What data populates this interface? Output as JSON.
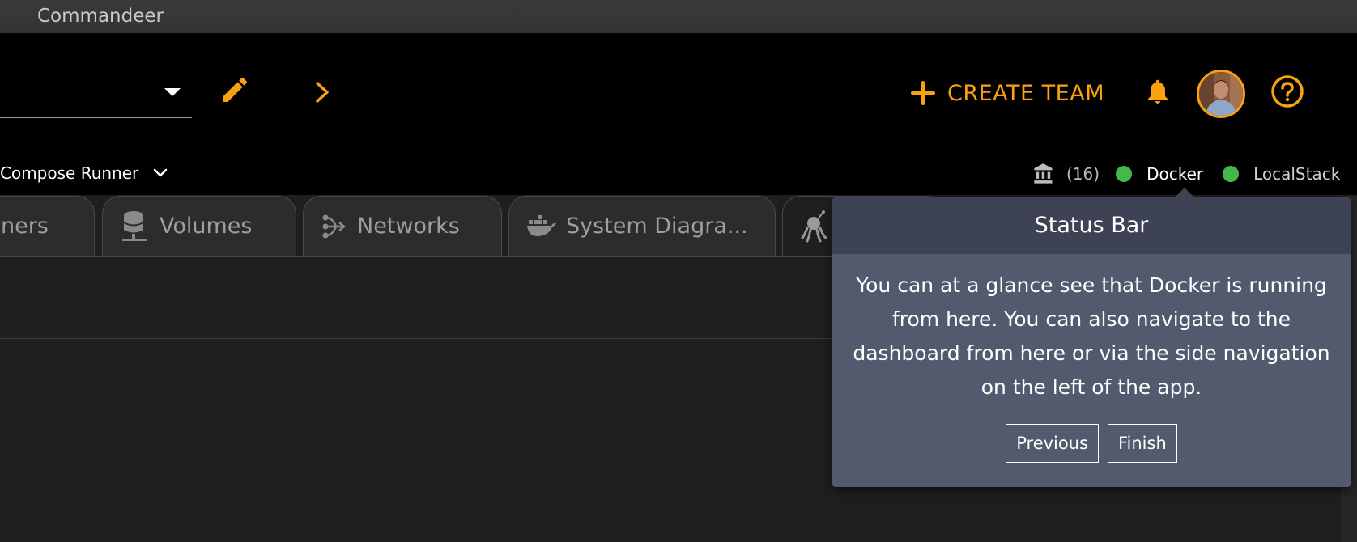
{
  "window": {
    "title": "Commandeer"
  },
  "header": {
    "create_team_label": "CREATE TEAM"
  },
  "subbar": {
    "runner_label": "Compose Runner"
  },
  "status_bar": {
    "count": "(16)",
    "docker_label": "Docker",
    "localstack_label": "LocalStack",
    "status_color": "#44b84a"
  },
  "tabs": [
    {
      "label": "ners",
      "icon": "containers-icon"
    },
    {
      "label": "Volumes",
      "icon": "database-icon"
    },
    {
      "label": "Networks",
      "icon": "network-icon"
    },
    {
      "label": "System Diagra...",
      "icon": "docker-whale-icon"
    },
    {
      "label": "",
      "icon": "octopus-icon"
    }
  ],
  "tooltip": {
    "title": "Status Bar",
    "body": "You can at a glance see that Docker is running from here. You can also navigate to the dashboard from here or via the side navigation on the left of the app.",
    "previous_label": "Previous",
    "finish_label": "Finish"
  },
  "colors": {
    "accent": "#f9a10f",
    "tooltip_bg": "#525a6e",
    "tooltip_head": "#3d4355"
  }
}
